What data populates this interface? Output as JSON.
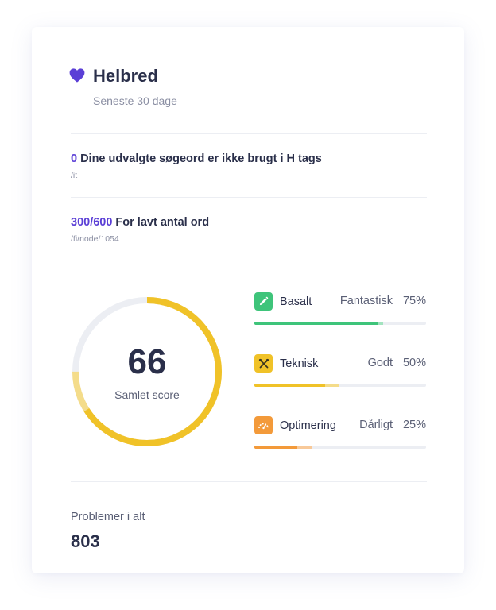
{
  "header": {
    "title": "Helbred",
    "subtitle": "Seneste 30 dage",
    "icon": "heart-icon",
    "icon_color": "#5b3fd6"
  },
  "issues": [
    {
      "count": "0",
      "text": "Dine udvalgte søgeord er ikke brugt i H tags",
      "path": "/it"
    },
    {
      "count": "300/600",
      "text": "For lavt antal ord",
      "path": "/fi/node/1054"
    }
  ],
  "score": {
    "value": "66",
    "label": "Samlet score",
    "fraction": 0.66,
    "previous_fraction": 0.75,
    "color": "#f0c228",
    "previous_color": "#f4dc8a",
    "track_color": "#eceef3"
  },
  "categories": [
    {
      "name": "Basalt",
      "status": "Fantastisk",
      "percent": "75%",
      "fraction": 0.75,
      "previous_fraction": 0.72,
      "icon": "pencil-icon",
      "color": "#3ec47a",
      "previous_color": "#a3e3bf"
    },
    {
      "name": "Teknisk",
      "status": "Godt",
      "percent": "50%",
      "fraction": 0.41,
      "previous_fraction": 0.49,
      "icon": "tools-icon",
      "color": "#f0c228",
      "previous_color": "#f4dc8a"
    },
    {
      "name": "Optimering",
      "status": "Dårligt",
      "percent": "25%",
      "fraction": 0.25,
      "previous_fraction": 0.34,
      "icon": "gauge-icon",
      "color": "#f39a3a",
      "previous_color": "#f8c999"
    }
  ],
  "totals": {
    "label": "Problemer i alt",
    "value": "803"
  },
  "colors": {
    "accent": "#5b3fd6",
    "text": "#2a2f4a",
    "muted": "#8b8fa3",
    "divider": "#eceef3"
  }
}
